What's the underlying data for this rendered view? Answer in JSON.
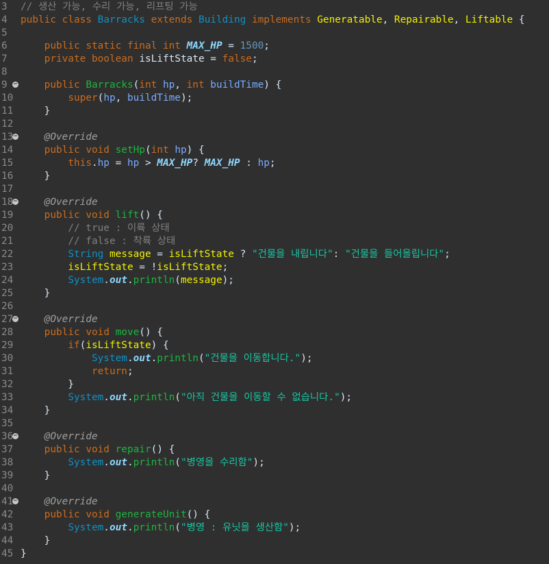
{
  "editor": {
    "lines": [
      {
        "n": "3",
        "fold": false,
        "tokens": [
          {
            "t": "// 생산 가능, 수리 가능, 리프팅 가능",
            "c": "co"
          }
        ]
      },
      {
        "n": "4",
        "fold": false,
        "tokens": [
          {
            "t": "public",
            "c": "kw"
          },
          {
            "t": " ",
            "c": "sp"
          },
          {
            "t": "class",
            "c": "kw"
          },
          {
            "t": " ",
            "c": "sp"
          },
          {
            "t": "Barracks",
            "c": "ty"
          },
          {
            "t": " ",
            "c": "sp"
          },
          {
            "t": "extends",
            "c": "kw"
          },
          {
            "t": " ",
            "c": "sp"
          },
          {
            "t": "Building",
            "c": "ty"
          },
          {
            "t": " ",
            "c": "sp"
          },
          {
            "t": "implements",
            "c": "kw"
          },
          {
            "t": " ",
            "c": "sp"
          },
          {
            "t": "Generatable",
            "c": "lv"
          },
          {
            "t": ", ",
            "c": "sp"
          },
          {
            "t": "Repairable",
            "c": "lv"
          },
          {
            "t": ", ",
            "c": "sp"
          },
          {
            "t": "Liftable",
            "c": "lv"
          },
          {
            "t": " {",
            "c": "sp"
          }
        ]
      },
      {
        "n": "5",
        "fold": false,
        "tokens": []
      },
      {
        "n": "6",
        "fold": false,
        "tokens": [
          {
            "t": "    ",
            "c": "sp"
          },
          {
            "t": "public",
            "c": "kw"
          },
          {
            "t": " ",
            "c": "sp"
          },
          {
            "t": "static",
            "c": "kw"
          },
          {
            "t": " ",
            "c": "sp"
          },
          {
            "t": "final",
            "c": "kw"
          },
          {
            "t": " ",
            "c": "sp"
          },
          {
            "t": "int",
            "c": "kw"
          },
          {
            "t": " ",
            "c": "sp"
          },
          {
            "t": "MAX_HP",
            "c": "cst"
          },
          {
            "t": " = ",
            "c": "sp"
          },
          {
            "t": "1500",
            "c": "nm"
          },
          {
            "t": ";",
            "c": "sp"
          }
        ]
      },
      {
        "n": "7",
        "fold": false,
        "tokens": [
          {
            "t": "    ",
            "c": "sp"
          },
          {
            "t": "private",
            "c": "kw"
          },
          {
            "t": " ",
            "c": "sp"
          },
          {
            "t": "boolean",
            "c": "kw"
          },
          {
            "t": " ",
            "c": "sp"
          },
          {
            "t": "isLiftState",
            "c": "id"
          },
          {
            "t": " = ",
            "c": "sp"
          },
          {
            "t": "false",
            "c": "kw"
          },
          {
            "t": ";",
            "c": "sp"
          }
        ]
      },
      {
        "n": "8",
        "fold": false,
        "tokens": []
      },
      {
        "n": "9",
        "fold": true,
        "tokens": [
          {
            "t": "    ",
            "c": "sp"
          },
          {
            "t": "public",
            "c": "kw"
          },
          {
            "t": " ",
            "c": "sp"
          },
          {
            "t": "Barracks",
            "c": "fn"
          },
          {
            "t": "(",
            "c": "sp"
          },
          {
            "t": "int",
            "c": "kw"
          },
          {
            "t": " ",
            "c": "sp"
          },
          {
            "t": "hp",
            "c": "pv"
          },
          {
            "t": ", ",
            "c": "sp"
          },
          {
            "t": "int",
            "c": "kw"
          },
          {
            "t": " ",
            "c": "sp"
          },
          {
            "t": "buildTime",
            "c": "pv"
          },
          {
            "t": ") {",
            "c": "sp"
          }
        ]
      },
      {
        "n": "10",
        "fold": false,
        "tokens": [
          {
            "t": "        ",
            "c": "sp"
          },
          {
            "t": "super",
            "c": "kw"
          },
          {
            "t": "(",
            "c": "sp"
          },
          {
            "t": "hp",
            "c": "pv"
          },
          {
            "t": ", ",
            "c": "sp"
          },
          {
            "t": "buildTime",
            "c": "pv"
          },
          {
            "t": ");",
            "c": "sp"
          }
        ]
      },
      {
        "n": "11",
        "fold": false,
        "tokens": [
          {
            "t": "    }",
            "c": "sp"
          }
        ]
      },
      {
        "n": "12",
        "fold": false,
        "tokens": []
      },
      {
        "n": "13",
        "fold": true,
        "tokens": [
          {
            "t": "    ",
            "c": "sp"
          },
          {
            "t": "@Override",
            "c": "an"
          }
        ]
      },
      {
        "n": "14",
        "fold": false,
        "tokens": [
          {
            "t": "    ",
            "c": "sp"
          },
          {
            "t": "public",
            "c": "kw"
          },
          {
            "t": " ",
            "c": "sp"
          },
          {
            "t": "void",
            "c": "kw"
          },
          {
            "t": " ",
            "c": "sp"
          },
          {
            "t": "setHp",
            "c": "fn"
          },
          {
            "t": "(",
            "c": "sp"
          },
          {
            "t": "int",
            "c": "kw"
          },
          {
            "t": " ",
            "c": "sp"
          },
          {
            "t": "hp",
            "c": "pv"
          },
          {
            "t": ") {",
            "c": "sp"
          }
        ]
      },
      {
        "n": "15",
        "fold": false,
        "tokens": [
          {
            "t": "        ",
            "c": "sp"
          },
          {
            "t": "this",
            "c": "kw"
          },
          {
            "t": ".",
            "c": "sp"
          },
          {
            "t": "hp",
            "c": "pv"
          },
          {
            "t": " = ",
            "c": "sp"
          },
          {
            "t": "hp",
            "c": "pv"
          },
          {
            "t": " > ",
            "c": "sp"
          },
          {
            "t": "MAX_HP",
            "c": "cst"
          },
          {
            "t": "? ",
            "c": "sp"
          },
          {
            "t": "MAX_HP",
            "c": "cst"
          },
          {
            "t": " : ",
            "c": "sp"
          },
          {
            "t": "hp",
            "c": "pv"
          },
          {
            "t": ";",
            "c": "sp"
          }
        ]
      },
      {
        "n": "16",
        "fold": false,
        "tokens": [
          {
            "t": "    }",
            "c": "sp"
          }
        ]
      },
      {
        "n": "17",
        "fold": false,
        "tokens": []
      },
      {
        "n": "18",
        "fold": true,
        "tokens": [
          {
            "t": "    ",
            "c": "sp"
          },
          {
            "t": "@Override",
            "c": "an"
          }
        ]
      },
      {
        "n": "19",
        "fold": false,
        "tokens": [
          {
            "t": "    ",
            "c": "sp"
          },
          {
            "t": "public",
            "c": "kw"
          },
          {
            "t": " ",
            "c": "sp"
          },
          {
            "t": "void",
            "c": "kw"
          },
          {
            "t": " ",
            "c": "sp"
          },
          {
            "t": "lift",
            "c": "fn"
          },
          {
            "t": "() {",
            "c": "sp"
          }
        ]
      },
      {
        "n": "20",
        "fold": false,
        "tokens": [
          {
            "t": "        ",
            "c": "sp"
          },
          {
            "t": "// true : 이륙 상태",
            "c": "co"
          }
        ]
      },
      {
        "n": "21",
        "fold": false,
        "tokens": [
          {
            "t": "        ",
            "c": "sp"
          },
          {
            "t": "// false : 착륙 상태",
            "c": "co"
          }
        ]
      },
      {
        "n": "22",
        "fold": false,
        "tokens": [
          {
            "t": "        ",
            "c": "sp"
          },
          {
            "t": "String",
            "c": "ty"
          },
          {
            "t": " ",
            "c": "sp"
          },
          {
            "t": "message",
            "c": "lv"
          },
          {
            "t": " = ",
            "c": "sp"
          },
          {
            "t": "isLiftState",
            "c": "lv"
          },
          {
            "t": " ? ",
            "c": "sp"
          },
          {
            "t": "\"건물을 내립니다\"",
            "c": "st"
          },
          {
            "t": ": ",
            "c": "sp"
          },
          {
            "t": "\"건물을 들어올립니다\"",
            "c": "st"
          },
          {
            "t": ";",
            "c": "sp"
          }
        ]
      },
      {
        "n": "23",
        "fold": false,
        "tokens": [
          {
            "t": "        ",
            "c": "sp"
          },
          {
            "t": "isLiftState",
            "c": "lv"
          },
          {
            "t": " = !",
            "c": "sp"
          },
          {
            "t": "isLiftState",
            "c": "lv"
          },
          {
            "t": ";",
            "c": "sp"
          }
        ]
      },
      {
        "n": "24",
        "fold": false,
        "tokens": [
          {
            "t": "        ",
            "c": "sp"
          },
          {
            "t": "System",
            "c": "ty"
          },
          {
            "t": ".",
            "c": "sp"
          },
          {
            "t": "out",
            "c": "out"
          },
          {
            "t": ".",
            "c": "sp"
          },
          {
            "t": "println",
            "c": "fn"
          },
          {
            "t": "(",
            "c": "sp"
          },
          {
            "t": "message",
            "c": "lv"
          },
          {
            "t": ");",
            "c": "sp"
          }
        ]
      },
      {
        "n": "25",
        "fold": false,
        "tokens": [
          {
            "t": "    }",
            "c": "sp"
          }
        ]
      },
      {
        "n": "26",
        "fold": false,
        "tokens": []
      },
      {
        "n": "27",
        "fold": true,
        "tokens": [
          {
            "t": "    ",
            "c": "sp"
          },
          {
            "t": "@Override",
            "c": "an"
          }
        ]
      },
      {
        "n": "28",
        "fold": false,
        "tokens": [
          {
            "t": "    ",
            "c": "sp"
          },
          {
            "t": "public",
            "c": "kw"
          },
          {
            "t": " ",
            "c": "sp"
          },
          {
            "t": "void",
            "c": "kw"
          },
          {
            "t": " ",
            "c": "sp"
          },
          {
            "t": "move",
            "c": "fn"
          },
          {
            "t": "() {",
            "c": "sp"
          }
        ]
      },
      {
        "n": "29",
        "fold": false,
        "tokens": [
          {
            "t": "        ",
            "c": "sp"
          },
          {
            "t": "if",
            "c": "kw"
          },
          {
            "t": "(",
            "c": "sp"
          },
          {
            "t": "isLiftState",
            "c": "lv"
          },
          {
            "t": ") {",
            "c": "sp"
          }
        ]
      },
      {
        "n": "30",
        "fold": false,
        "tokens": [
          {
            "t": "            ",
            "c": "sp"
          },
          {
            "t": "System",
            "c": "ty"
          },
          {
            "t": ".",
            "c": "sp"
          },
          {
            "t": "out",
            "c": "out"
          },
          {
            "t": ".",
            "c": "sp"
          },
          {
            "t": "println",
            "c": "fn"
          },
          {
            "t": "(",
            "c": "sp"
          },
          {
            "t": "\"건물을 이동합니다.\"",
            "c": "st"
          },
          {
            "t": ");",
            "c": "sp"
          }
        ]
      },
      {
        "n": "31",
        "fold": false,
        "tokens": [
          {
            "t": "            ",
            "c": "sp"
          },
          {
            "t": "return",
            "c": "kw"
          },
          {
            "t": ";",
            "c": "sp"
          }
        ]
      },
      {
        "n": "32",
        "fold": false,
        "tokens": [
          {
            "t": "        }",
            "c": "sp"
          }
        ]
      },
      {
        "n": "33",
        "fold": false,
        "tokens": [
          {
            "t": "        ",
            "c": "sp"
          },
          {
            "t": "System",
            "c": "ty"
          },
          {
            "t": ".",
            "c": "sp"
          },
          {
            "t": "out",
            "c": "out"
          },
          {
            "t": ".",
            "c": "sp"
          },
          {
            "t": "println",
            "c": "fn"
          },
          {
            "t": "(",
            "c": "sp"
          },
          {
            "t": "\"아직 건물을 이동할 수 없습니다.\"",
            "c": "st"
          },
          {
            "t": ");",
            "c": "sp"
          }
        ]
      },
      {
        "n": "34",
        "fold": false,
        "tokens": [
          {
            "t": "    }",
            "c": "sp"
          }
        ]
      },
      {
        "n": "35",
        "fold": false,
        "tokens": []
      },
      {
        "n": "36",
        "fold": true,
        "tokens": [
          {
            "t": "    ",
            "c": "sp"
          },
          {
            "t": "@Override",
            "c": "an"
          }
        ]
      },
      {
        "n": "37",
        "fold": false,
        "tokens": [
          {
            "t": "    ",
            "c": "sp"
          },
          {
            "t": "public",
            "c": "kw"
          },
          {
            "t": " ",
            "c": "sp"
          },
          {
            "t": "void",
            "c": "kw"
          },
          {
            "t": " ",
            "c": "sp"
          },
          {
            "t": "repair",
            "c": "fn"
          },
          {
            "t": "() {",
            "c": "sp"
          }
        ]
      },
      {
        "n": "38",
        "fold": false,
        "tokens": [
          {
            "t": "        ",
            "c": "sp"
          },
          {
            "t": "System",
            "c": "ty"
          },
          {
            "t": ".",
            "c": "sp"
          },
          {
            "t": "out",
            "c": "out"
          },
          {
            "t": ".",
            "c": "sp"
          },
          {
            "t": "println",
            "c": "fn"
          },
          {
            "t": "(",
            "c": "sp"
          },
          {
            "t": "\"병영을 수리함\"",
            "c": "st"
          },
          {
            "t": ");",
            "c": "sp"
          }
        ]
      },
      {
        "n": "39",
        "fold": false,
        "tokens": [
          {
            "t": "    }",
            "c": "sp"
          }
        ]
      },
      {
        "n": "40",
        "fold": false,
        "tokens": []
      },
      {
        "n": "41",
        "fold": true,
        "tokens": [
          {
            "t": "    ",
            "c": "sp"
          },
          {
            "t": "@Override",
            "c": "an"
          }
        ]
      },
      {
        "n": "42",
        "fold": false,
        "tokens": [
          {
            "t": "    ",
            "c": "sp"
          },
          {
            "t": "public",
            "c": "kw"
          },
          {
            "t": " ",
            "c": "sp"
          },
          {
            "t": "void",
            "c": "kw"
          },
          {
            "t": " ",
            "c": "sp"
          },
          {
            "t": "generateUnit",
            "c": "fn"
          },
          {
            "t": "() {",
            "c": "sp"
          }
        ]
      },
      {
        "n": "43",
        "fold": false,
        "tokens": [
          {
            "t": "        ",
            "c": "sp"
          },
          {
            "t": "System",
            "c": "ty"
          },
          {
            "t": ".",
            "c": "sp"
          },
          {
            "t": "out",
            "c": "out"
          },
          {
            "t": ".",
            "c": "sp"
          },
          {
            "t": "println",
            "c": "fn"
          },
          {
            "t": "(",
            "c": "sp"
          },
          {
            "t": "\"병영 : 유닛을 생산함\"",
            "c": "st"
          },
          {
            "t": ");",
            "c": "sp"
          }
        ]
      },
      {
        "n": "44",
        "fold": false,
        "tokens": [
          {
            "t": "    }",
            "c": "sp"
          }
        ]
      },
      {
        "n": "45",
        "fold": false,
        "tokens": [
          {
            "t": "}",
            "c": "sp"
          }
        ]
      }
    ]
  }
}
